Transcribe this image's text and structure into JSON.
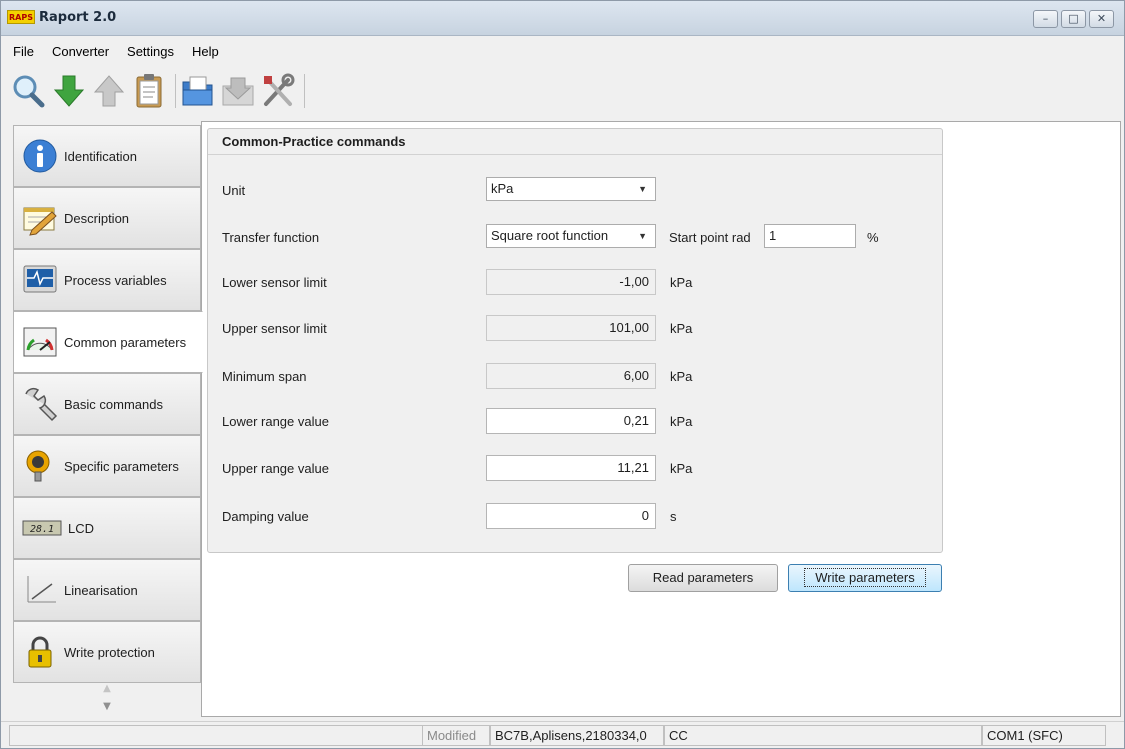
{
  "window": {
    "icon_text": "RAPS",
    "title": "Raport 2.0",
    "controls": [
      "–",
      "□",
      "✕"
    ]
  },
  "menu": [
    "File",
    "Converter",
    "Settings",
    "Help"
  ],
  "toolbar": {
    "icons": [
      "search-icon",
      "download-arrow-icon",
      "upload-arrow-icon",
      "clipboard-icon",
      "open-folder-icon",
      "save-disabled-icon",
      "tools-icon"
    ]
  },
  "sidebar": {
    "items": [
      {
        "label": "Identification",
        "icon": "info-icon"
      },
      {
        "label": "Description",
        "icon": "notepad-pencil-icon"
      },
      {
        "label": "Process variables",
        "icon": "waveform-monitor-icon"
      },
      {
        "label": "Common parameters",
        "icon": "gauge-icon"
      },
      {
        "label": "Basic commands",
        "icon": "wrench-icon"
      },
      {
        "label": "Specific parameters",
        "icon": "transmitter-icon"
      },
      {
        "label": "LCD",
        "icon": "lcd-display-icon",
        "icon_text": "28.1"
      },
      {
        "label": "Linearisation",
        "icon": "linear-graph-icon"
      },
      {
        "label": "Write protection",
        "icon": "padlock-icon"
      }
    ],
    "active": "Common parameters",
    "scroll_up": "▲",
    "scroll_down": "▼"
  },
  "main": {
    "group_title": "Common-Practice commands",
    "unit": {
      "label": "Unit",
      "value": "kPa"
    },
    "transfer_function": {
      "label": "Transfer function",
      "value": "Square root function"
    },
    "start_point": {
      "label": "Start point rad",
      "value": "1",
      "unit": "%"
    },
    "lower_sensor_limit": {
      "label": "Lower sensor limit",
      "value": "-1,00",
      "unit": "kPa"
    },
    "upper_sensor_limit": {
      "label": "Upper sensor limit",
      "value": "101,00",
      "unit": "kPa"
    },
    "minimum_span": {
      "label": "Minimum span",
      "value": "6,00",
      "unit": "kPa"
    },
    "lower_range_value": {
      "label": "Lower range value",
      "value": "0,21",
      "unit": "kPa"
    },
    "upper_range_value": {
      "label": "Upper range value",
      "value": "11,21",
      "unit": "kPa"
    },
    "damping_value": {
      "label": "Damping value",
      "value": "0",
      "unit": "s"
    },
    "read_button": "Read parameters",
    "write_button": "Write parameters"
  },
  "status": {
    "modified": "Modified",
    "device": "BC7B,Aplisens,2180334,0",
    "mode": "CC",
    "port": "COM1 (SFC)"
  }
}
